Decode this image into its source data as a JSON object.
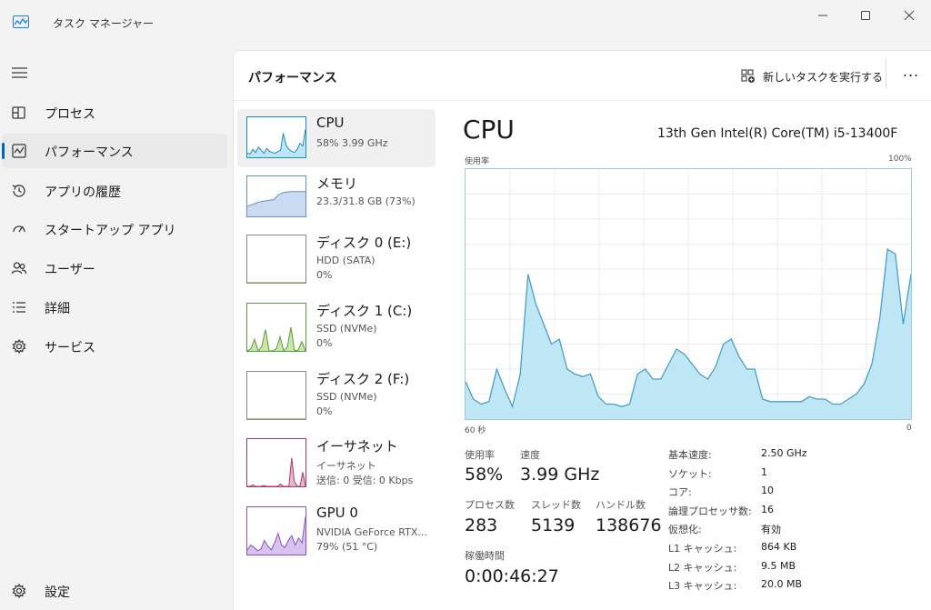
{
  "app": {
    "title": "タスク マネージャー"
  },
  "nav": {
    "items": [
      {
        "label": "プロセス",
        "icon": "processes-icon"
      },
      {
        "label": "パフォーマンス",
        "icon": "performance-icon",
        "active": true
      },
      {
        "label": "アプリの履歴",
        "icon": "history-icon"
      },
      {
        "label": "スタートアップ アプリ",
        "icon": "startup-icon"
      },
      {
        "label": "ユーザー",
        "icon": "users-icon"
      },
      {
        "label": "詳細",
        "icon": "details-icon"
      },
      {
        "label": "サービス",
        "icon": "services-icon"
      }
    ],
    "settings": {
      "label": "設定",
      "icon": "gear-icon"
    }
  },
  "header": {
    "title": "パフォーマンス",
    "run_task_label": "新しいタスクを実行する",
    "more_label": "..."
  },
  "perf_list": [
    {
      "name": "CPU",
      "sub1": "58%  3.99 GHz",
      "thumb_values": [
        10,
        8,
        20,
        12,
        25,
        18,
        10,
        22,
        15,
        12,
        10,
        14,
        18,
        60,
        30,
        20,
        15,
        12,
        20,
        35,
        28,
        70
      ],
      "color": "#1a8dbf",
      "fill": "#bfe6f5"
    },
    {
      "name": "メモリ",
      "sub1": "23.3/31.8 GB (73%)",
      "thumb_values": [
        25,
        30,
        35,
        38,
        40,
        42,
        55,
        60,
        62,
        62,
        62,
        62
      ],
      "color": "#6b8fc2",
      "fill": "#c9dcf2"
    },
    {
      "name": "ディスク 0 (E:)",
      "sub1": "HDD (SATA)",
      "sub2": "0%",
      "thumb_values": [
        0,
        0,
        0,
        0,
        0,
        0,
        0,
        0,
        0,
        0,
        0,
        0
      ],
      "color": "#5a9a3a",
      "fill": "#dcefc9"
    },
    {
      "name": "ディスク 1 (C:)",
      "sub1": "SSD (NVMe)",
      "sub2": "0%",
      "thumb_values": [
        0,
        5,
        25,
        0,
        10,
        45,
        0,
        0,
        5,
        30,
        0,
        8,
        50,
        0,
        2,
        20,
        0
      ],
      "color": "#5a9a3a",
      "fill": "#cce6a8"
    },
    {
      "name": "ディスク 2 (F:)",
      "sub1": "SSD (NVMe)",
      "sub2": "0%",
      "thumb_values": [
        0,
        0,
        0,
        0,
        0,
        0,
        0,
        0,
        0,
        0,
        0,
        0
      ],
      "color": "#5a9a3a",
      "fill": "#dcefc9"
    },
    {
      "name": "イーサネット",
      "sub1": "イーサネット",
      "sub2": "送信: 0 受信: 0 Kbps",
      "thumb_values": [
        0,
        0,
        3,
        0,
        0,
        0,
        2,
        0,
        0,
        0,
        0,
        0,
        5,
        0,
        0,
        0,
        60,
        10,
        0,
        0,
        30,
        0
      ],
      "color": "#a8386a",
      "fill": "#e8b8cc"
    },
    {
      "name": "GPU 0",
      "sub1": "NVIDIA GeForce RTX...",
      "sub2": "79%  (51 °C)",
      "thumb_values": [
        10,
        20,
        15,
        8,
        12,
        30,
        18,
        10,
        25,
        45,
        20,
        15,
        30,
        40,
        20,
        35,
        25,
        80
      ],
      "color": "#8a4fc6",
      "fill": "#d8c2f0"
    }
  ],
  "detail": {
    "title": "CPU",
    "model": "13th Gen Intel(R) Core(TM) i5-13400F",
    "graph_ylabel": "使用率",
    "graph_ymax": "100%",
    "graph_xleft": "60 秒",
    "graph_xright": "0",
    "stats": {
      "usage_label": "使用率",
      "usage_value": "58%",
      "speed_label": "速度",
      "speed_value": "3.99 GHz",
      "processes_label": "プロセス数",
      "processes_value": "283",
      "threads_label": "スレッド数",
      "threads_value": "5139",
      "handles_label": "ハンドル数",
      "handles_value": "138676",
      "uptime_label": "稼働時間",
      "uptime_value": "0:00:46:27"
    },
    "specs": [
      {
        "key": "基本速度:",
        "value": "2.50 GHz"
      },
      {
        "key": "ソケット:",
        "value": "1"
      },
      {
        "key": "コア:",
        "value": "10"
      },
      {
        "key": "論理プロセッサ数:",
        "value": "16"
      },
      {
        "key": "仮想化:",
        "value": "有効"
      },
      {
        "key": "L1 キャッシュ:",
        "value": "864 KB"
      },
      {
        "key": "L2 キャッシュ:",
        "value": "9.5 MB"
      },
      {
        "key": "L3 キャッシュ:",
        "value": "20.0 MB"
      }
    ]
  },
  "chart_data": {
    "type": "area",
    "ylim": [
      0,
      100
    ],
    "x_range_seconds": [
      60,
      0
    ],
    "values": [
      15,
      8,
      6,
      7,
      20,
      12,
      5,
      18,
      58,
      46,
      38,
      30,
      32,
      20,
      18,
      17,
      18,
      9,
      6,
      6,
      5,
      6,
      18,
      20,
      16,
      16,
      22,
      28,
      26,
      22,
      18,
      16,
      21,
      30,
      32,
      25,
      20,
      20,
      8,
      7,
      7,
      7,
      7,
      7,
      9,
      8,
      8,
      6,
      6,
      8,
      10,
      14,
      22,
      40,
      68,
      66,
      38,
      58
    ],
    "color": "#4a9fc8",
    "fill": "#bfe6f5",
    "grid": true
  },
  "colors": {
    "accent": "#0067c0",
    "cpu_line": "#4a9fc8",
    "cpu_fill": "#bfe6f5"
  }
}
